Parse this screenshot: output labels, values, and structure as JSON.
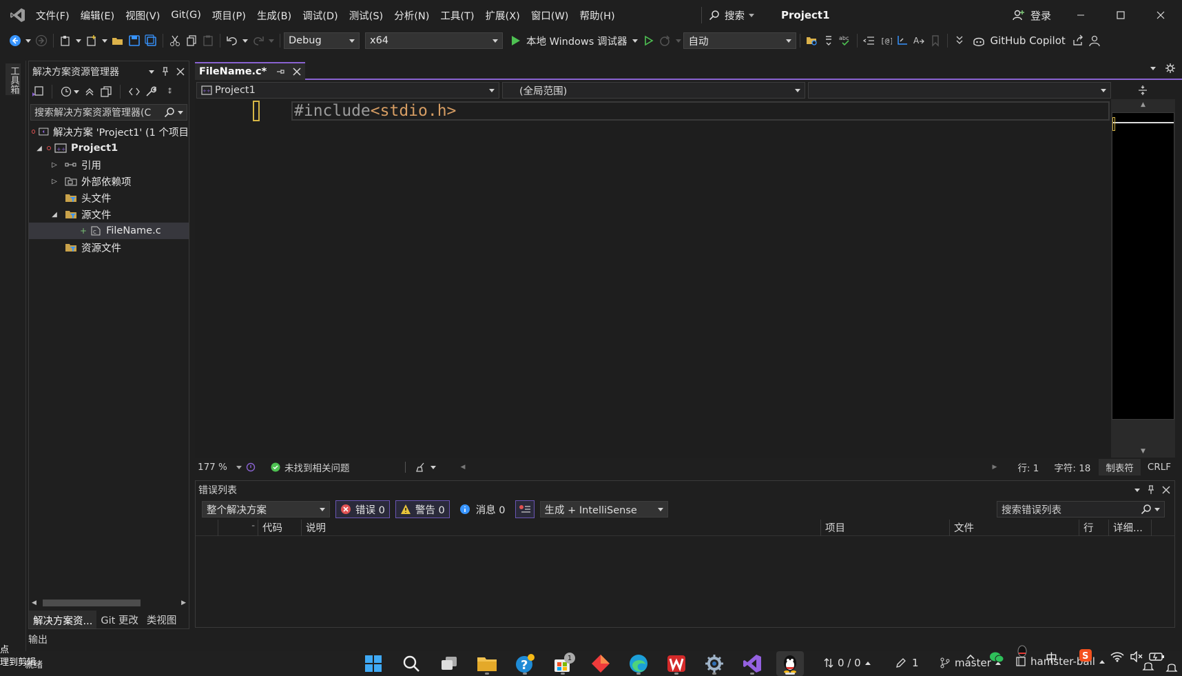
{
  "menu": [
    "文件(F)",
    "编辑(E)",
    "视图(V)",
    "Git(G)",
    "项目(P)",
    "生成(B)",
    "调试(D)",
    "测试(S)",
    "分析(N)",
    "工具(T)",
    "扩展(X)",
    "窗口(W)",
    "帮助(H)"
  ],
  "search_label": "搜索",
  "project_title": "Project1",
  "login_label": "登录",
  "toolbar": {
    "config": "Debug",
    "platform": "x64",
    "run_label": "本地 Windows 调试器",
    "mode": "自动",
    "copilot_label": "GitHub Copilot"
  },
  "toolbox_tab": "工具箱",
  "solution_explorer": {
    "title": "解决方案资源管理器",
    "search_placeholder": "搜索解决方案资源管理器(C",
    "tree": [
      {
        "label": "解决方案 'Project1' (1 个项目",
        "depth": 0
      },
      {
        "label": "Project1",
        "depth": 1
      },
      {
        "label": "引用",
        "depth": 2
      },
      {
        "label": "外部依赖项",
        "depth": 2
      },
      {
        "label": "头文件",
        "depth": 2
      },
      {
        "label": "源文件",
        "depth": 2
      },
      {
        "label": "FileName.c",
        "depth": 3
      },
      {
        "label": "资源文件",
        "depth": 2
      }
    ],
    "tabs": [
      "解决方案资...",
      "Git 更改",
      "类视图"
    ]
  },
  "editor": {
    "tab_label": "FileName.c*",
    "nav_project": "Project1",
    "nav_scope": "(全局范围)",
    "code_prefix": "#include",
    "code_header": "<stdio.h>",
    "zoom": "177 %",
    "issues": "未找到相关问题",
    "line": "行: 1",
    "char": "字符: 18",
    "indent": "制表符",
    "eol": "CRLF"
  },
  "error_list": {
    "title": "错误列表",
    "scope": "整个解决方案",
    "errors": "错误 0",
    "warnings": "警告 0",
    "messages": "消息 0",
    "source": "生成 + IntelliSense",
    "search_placeholder": "搜索错误列表",
    "columns": [
      "代码",
      "说明",
      "项目",
      "文件",
      "行",
      "详细..."
    ]
  },
  "output_label": "输出",
  "taskbar": {
    "left_text_1": "点",
    "left_text_2": "理到剪辑",
    "ready": "就绪",
    "sync": "0 / 0",
    "edits": "1",
    "branch": "master",
    "repo": "hamster-ball",
    "ime": "中",
    "store_badge": "1"
  },
  "colors": {
    "accent": "#8a63d2",
    "bg": "#1f1f1f",
    "error": "#e05252",
    "warning": "#e8c33a",
    "info": "#3794ff"
  }
}
